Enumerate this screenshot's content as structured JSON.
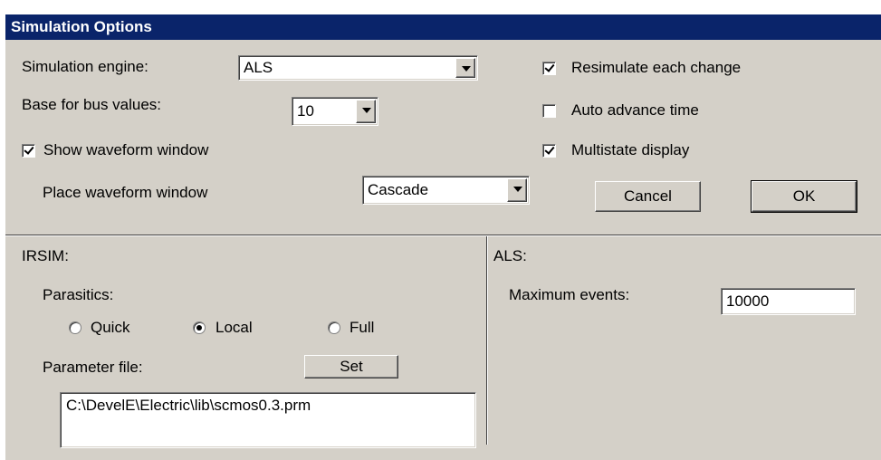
{
  "window": {
    "title": "Simulation Options"
  },
  "engine": {
    "label": "Simulation engine:",
    "value": "ALS"
  },
  "bus_base": {
    "label": "Base for bus values:",
    "value": "10"
  },
  "show_waveform": {
    "label": "Show waveform window",
    "checked": true
  },
  "place_waveform": {
    "label": "Place waveform window",
    "value": "Cascade"
  },
  "options": {
    "resimulate": {
      "label": "Resimulate each change",
      "checked": true
    },
    "auto_advance": {
      "label": "Auto advance time",
      "checked": false
    },
    "multistate": {
      "label": "Multistate display",
      "checked": true
    }
  },
  "buttons": {
    "cancel": "Cancel",
    "ok": "OK",
    "set": "Set"
  },
  "irsim": {
    "title": "IRSIM:",
    "parasitics_label": "Parasitics:",
    "parasitics_options": [
      "Quick",
      "Local",
      "Full"
    ],
    "parasitics_selected": "Local",
    "param_file_label": "Parameter file:",
    "param_file_value": "C:\\DevelE\\Electric\\lib\\scmos0.3.prm"
  },
  "als": {
    "title": "ALS:",
    "max_events_label": "Maximum events:",
    "max_events_value": "10000"
  }
}
